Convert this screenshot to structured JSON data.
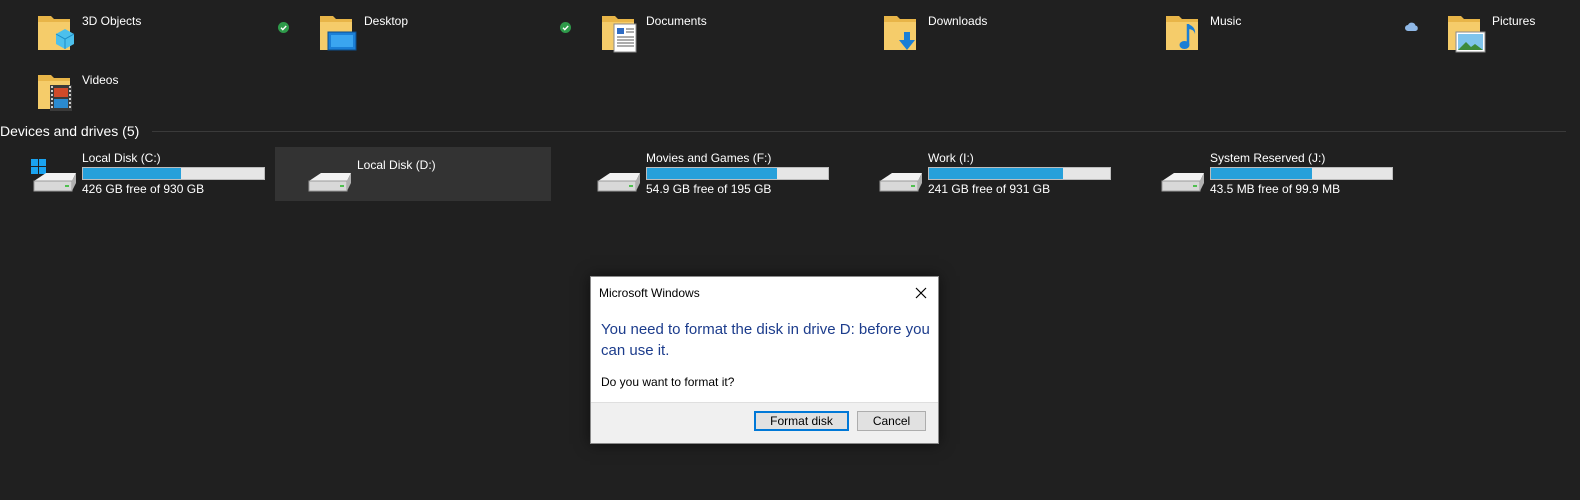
{
  "folders": [
    {
      "label": "3D Objects",
      "icon": "3d-objects-folder-icon",
      "sync": "synced"
    },
    {
      "label": "Desktop",
      "icon": "desktop-folder-icon",
      "sync": "synced"
    },
    {
      "label": "Documents",
      "icon": "documents-folder-icon",
      "sync": ""
    },
    {
      "label": "Downloads",
      "icon": "downloads-folder-icon",
      "sync": ""
    },
    {
      "label": "Music",
      "icon": "music-folder-icon",
      "sync": "cloud"
    },
    {
      "label": "Pictures",
      "icon": "pictures-folder-icon",
      "sync": ""
    },
    {
      "label": "Videos",
      "icon": "videos-folder-icon",
      "sync": ""
    }
  ],
  "devices": {
    "header": "Devices and drives (5)",
    "drives": [
      {
        "name": "Local Disk (C:)",
        "free": "426 GB free of 930 GB",
        "used_fraction": 0.54,
        "system": true
      },
      {
        "name": "Local Disk (D:)",
        "free": "",
        "selected": true
      },
      {
        "name": "Movies and Games (F:)",
        "free": "54.9 GB free of 195 GB",
        "used_fraction": 0.72
      },
      {
        "name": "Work (I:)",
        "free": "241 GB free of 931 GB",
        "used_fraction": 0.74
      },
      {
        "name": "System Reserved (J:)",
        "free": "43.5 MB free of 99.9 MB",
        "used_fraction": 0.56
      }
    ]
  },
  "dialog": {
    "title": "Microsoft Windows",
    "message": "You need to format the disk in drive D: before you can use it.",
    "question": "Do you want to format it?",
    "primary_button": "Format disk",
    "cancel_button": "Cancel"
  },
  "colors": {
    "background": "#202020",
    "usage_bar": "#26a0da",
    "dialog_message": "#1c3c8c",
    "sync_ok": "#2e9a4a",
    "accent": "#0078d7"
  }
}
